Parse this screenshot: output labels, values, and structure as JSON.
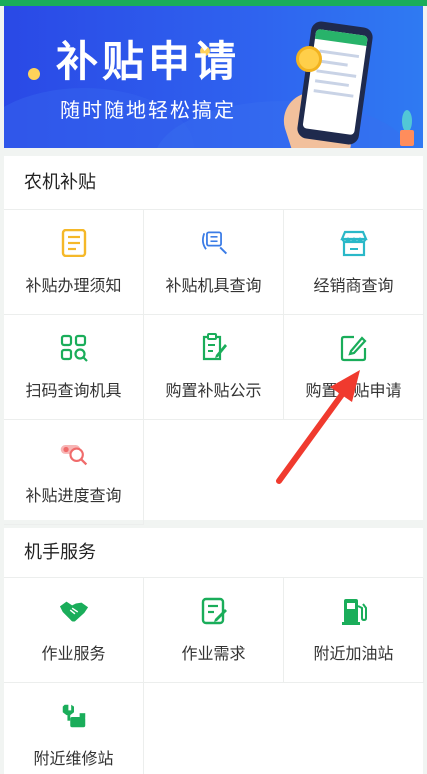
{
  "banner": {
    "title": "补贴申请",
    "subtitle": "随时随地轻松搞定"
  },
  "sections": [
    {
      "title": "农机补贴",
      "items": [
        {
          "label": "补贴办理须知",
          "icon": "document-list-icon"
        },
        {
          "label": "补贴机具查询",
          "icon": "subsidy-search-icon"
        },
        {
          "label": "经销商查询",
          "icon": "store-icon"
        },
        {
          "label": "扫码查询机具",
          "icon": "scan-code-icon"
        },
        {
          "label": "购置补贴公示",
          "icon": "clipboard-edit-icon"
        },
        {
          "label": "购置补贴申请",
          "icon": "edit-square-icon"
        },
        {
          "label": "补贴进度查询",
          "icon": "progress-search-icon"
        }
      ]
    },
    {
      "title": "机手服务",
      "items": [
        {
          "label": "作业服务",
          "icon": "handshake-icon"
        },
        {
          "label": "作业需求",
          "icon": "form-edit-icon"
        },
        {
          "label": "附近加油站",
          "icon": "gas-station-icon"
        },
        {
          "label": "附近维修站",
          "icon": "repair-icon"
        }
      ]
    }
  ],
  "colors": {
    "accent_green": "#1aad5a",
    "icon_yellow": "#f5b828",
    "icon_blue": "#3b7ce6",
    "icon_cyan": "#2ab8c8",
    "icon_red": "#f08080",
    "annotation_red": "#f03a2e"
  }
}
